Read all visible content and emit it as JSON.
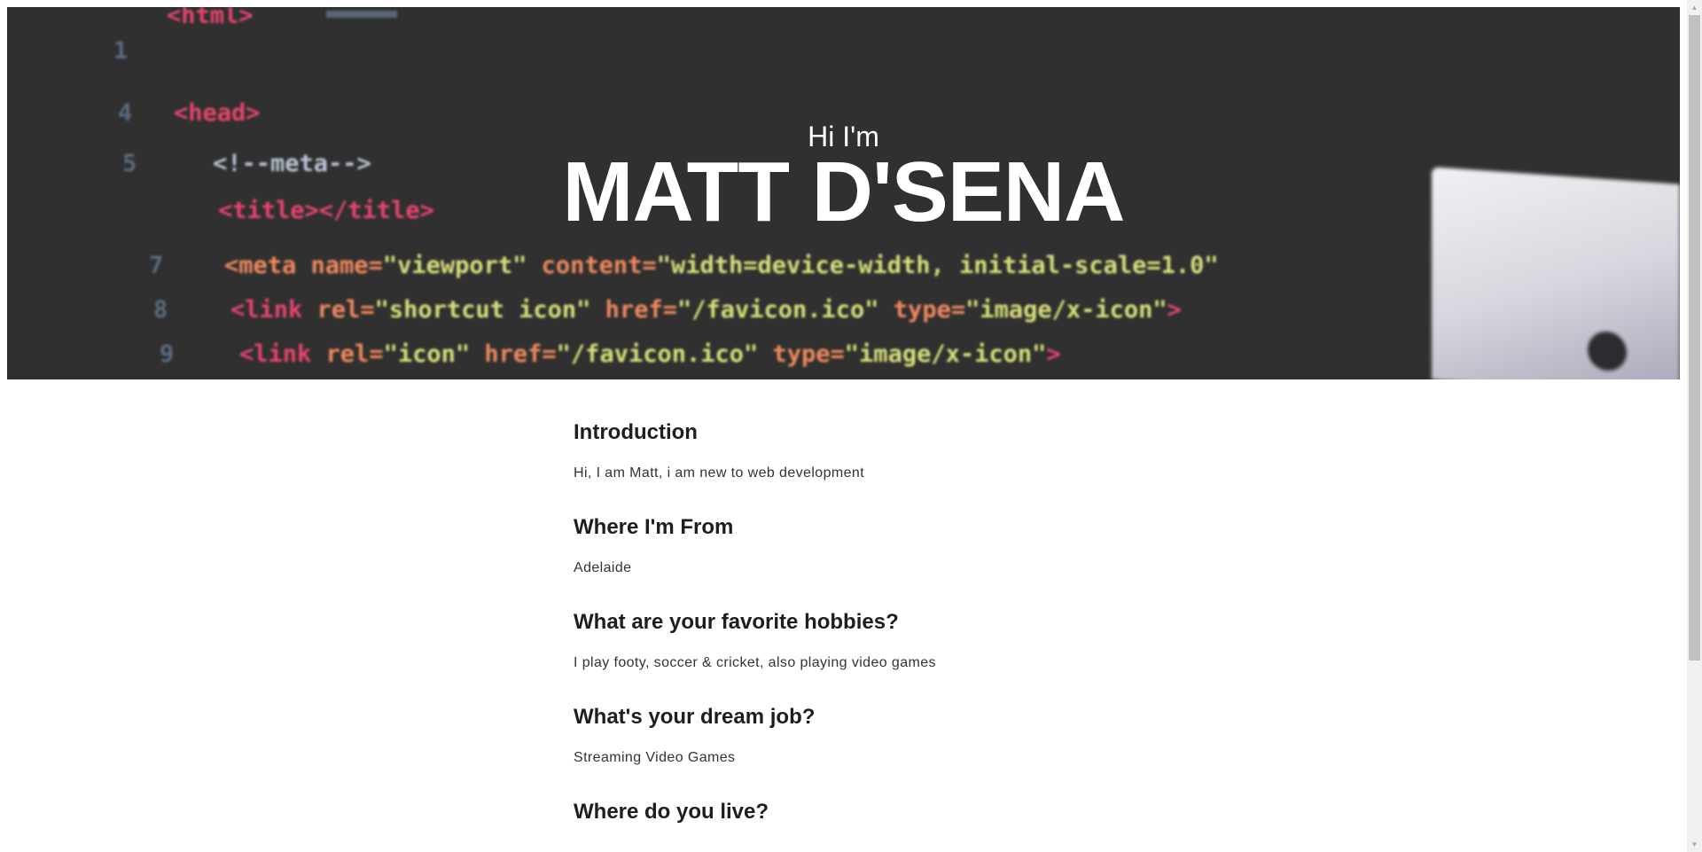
{
  "hero": {
    "greeting": "Hi I'm",
    "name": "MATT D'SENA",
    "background_code_lines": [
      "<head>",
      "<!--meta-->",
      "<title></title>",
      "<meta name=\"viewport\" content=\"width=device-width, initial-scale=1.0\">",
      "<link rel=\"shortcut icon\" href=\"/favicon.ico\" type=\"image/x-icon\">",
      "<link rel=\"icon\" href=\"/favicon.ico\" type=\"image/x-icon\">"
    ]
  },
  "sections": [
    {
      "heading": "Introduction",
      "text": "Hi, I am Matt, i am new to web development"
    },
    {
      "heading": "Where I'm From",
      "text": "Adelaide"
    },
    {
      "heading": "What are your favorite hobbies?",
      "text": "I play footy, soccer & cricket, also playing video games"
    },
    {
      "heading": "What's your dream job?",
      "text": "Streaming Video Games"
    },
    {
      "heading": "Where do you live?",
      "text": ""
    }
  ],
  "colors": {
    "hero_bg": "#303030",
    "tag_pink": "#e8456f",
    "attr_orange": "#f08a5d",
    "string_yellow": "#d9e07a",
    "text_dark": "#1e1e1e"
  }
}
